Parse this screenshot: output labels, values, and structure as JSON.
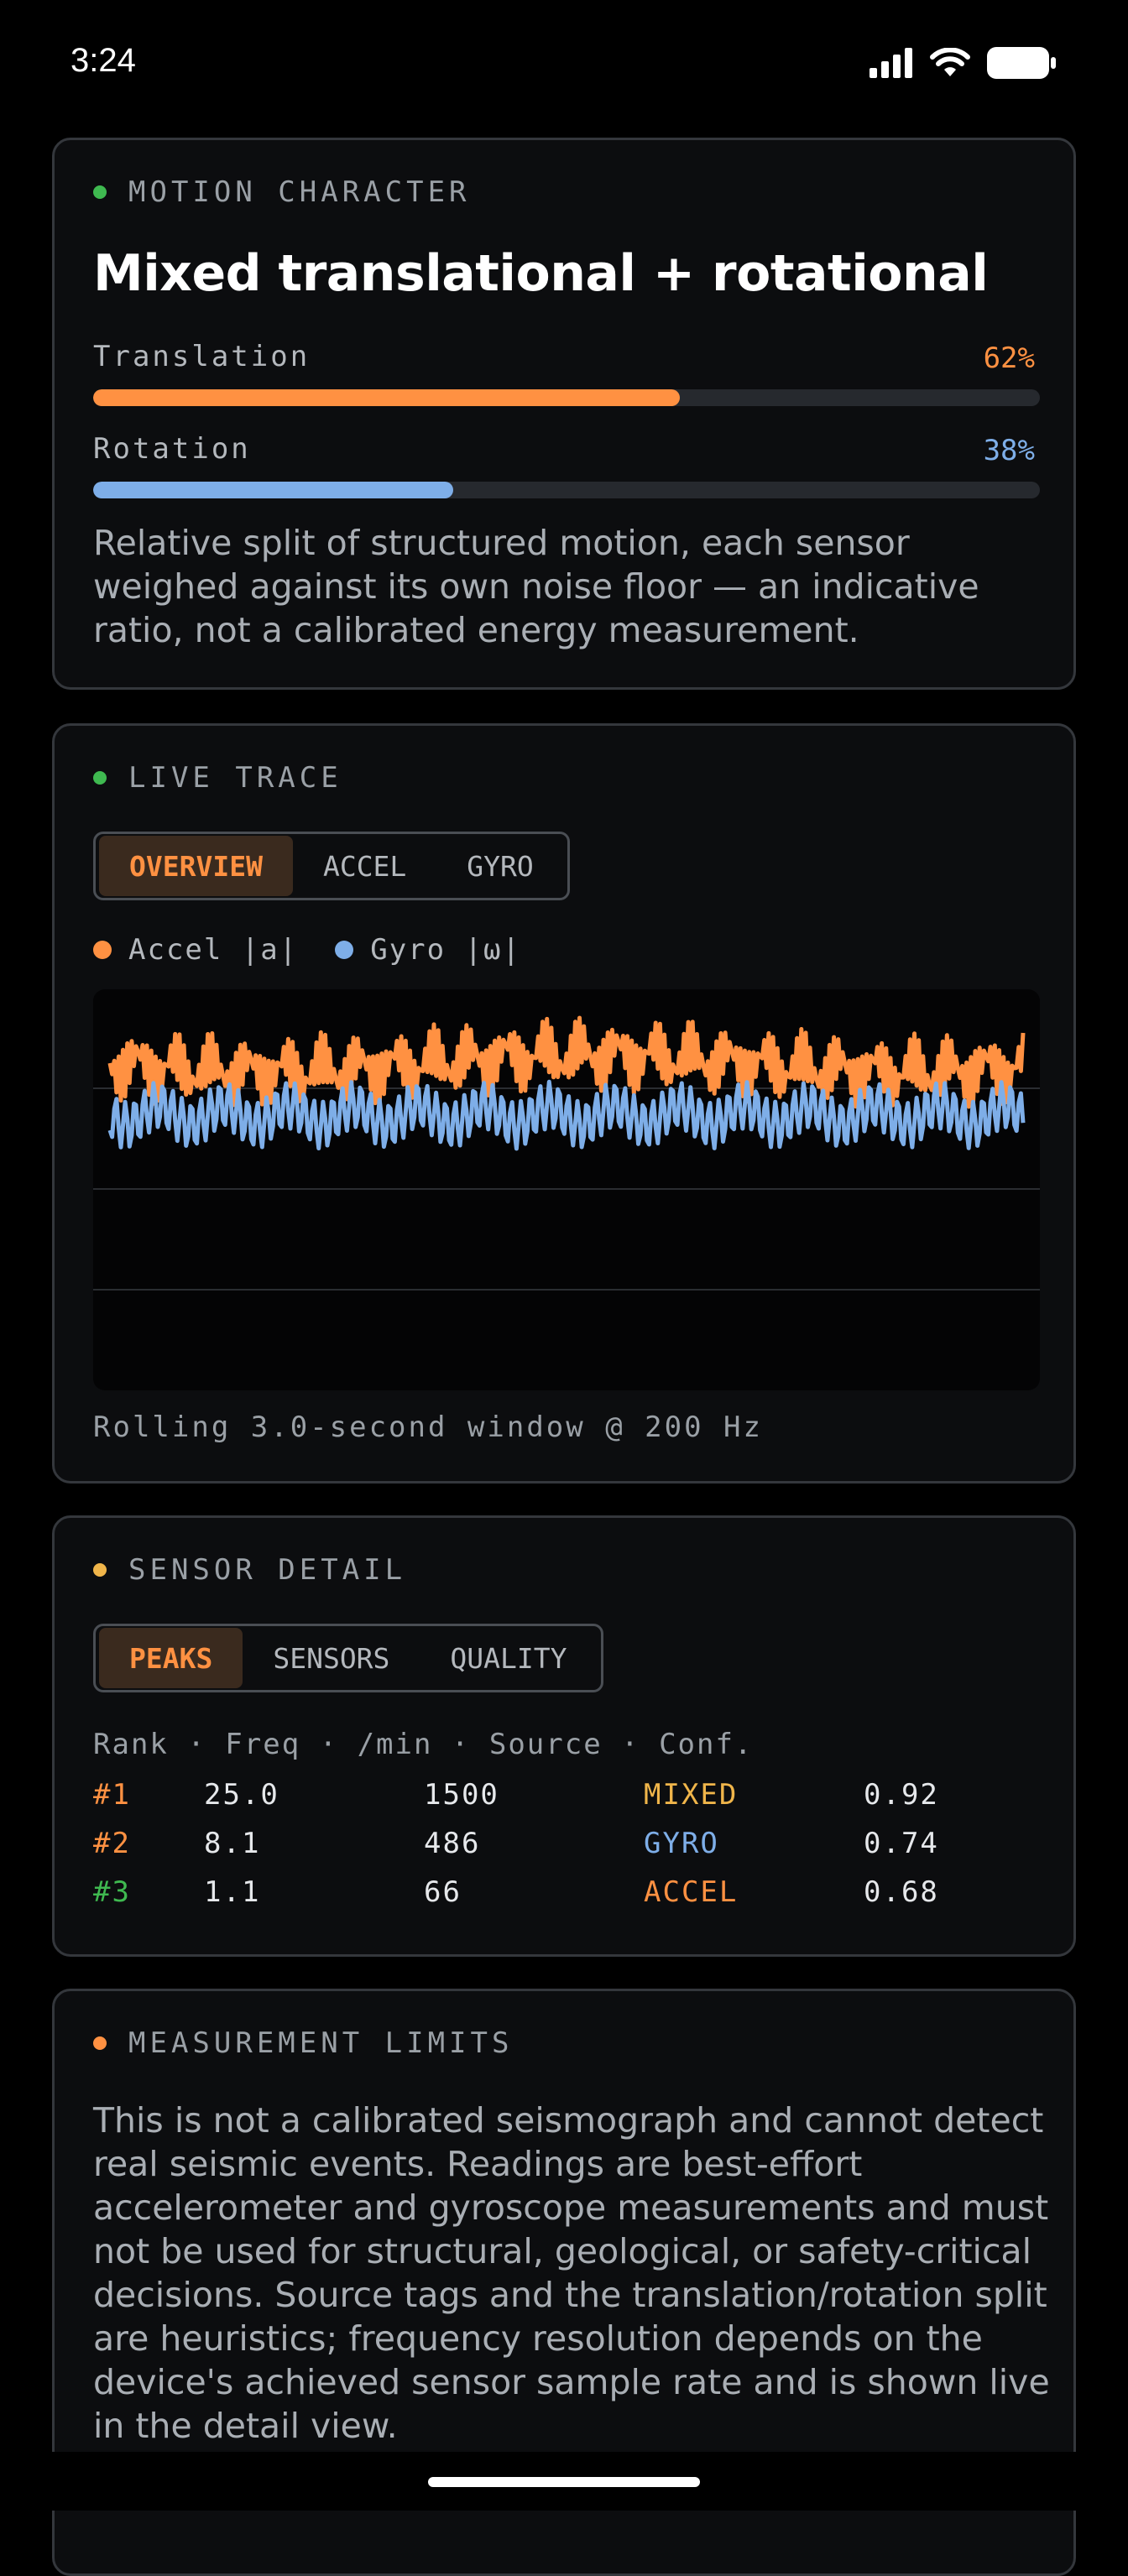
{
  "status_bar": {
    "time": "3:24"
  },
  "motion": {
    "title": "MOTION CHARACTER",
    "dot_color": "#3fb950",
    "headline": "Mixed translational + rotational",
    "translation": {
      "label": "Translation",
      "value_text": "62%",
      "fraction": 0.62,
      "color": "#ff9142"
    },
    "rotation": {
      "label": "Rotation",
      "value_text": "38%",
      "fraction": 0.38,
      "color": "#7eaee8"
    },
    "description": "Relative split of structured motion, each sensor weighed against its own noise floor — an indicative ratio, not a calibrated energy measurement."
  },
  "live": {
    "title": "LIVE TRACE",
    "dot_color": "#3fb950",
    "tabs": [
      "OVERVIEW",
      "ACCEL",
      "GYRO"
    ],
    "active_tab": "OVERVIEW",
    "legend": [
      {
        "label": "Accel |a|",
        "color": "#ff9142"
      },
      {
        "label": "Gyro |ω|",
        "color": "#7eaee8"
      }
    ],
    "caption": "Rolling 3.0-second window @ 200 Hz"
  },
  "sensor": {
    "title": "SENSOR DETAIL",
    "dot_color": "#f0b54a",
    "tabs": [
      "PEAKS",
      "SENSORS",
      "QUALITY"
    ],
    "active_tab": "PEAKS",
    "header": "Rank · Freq · /min · Source · Conf.",
    "rows": [
      {
        "rank": "#1",
        "freq": "25.0",
        "per_min": "1500",
        "source": "MIXED",
        "conf": "0.92",
        "rank_color": "#ff9142",
        "source_color": "#f0b54a"
      },
      {
        "rank": "#2",
        "freq": "8.1",
        "per_min": "486",
        "source": "GYRO",
        "conf": "0.74",
        "rank_color": "#ff9142",
        "source_color": "#7eaee8"
      },
      {
        "rank": "#3",
        "freq": "1.1",
        "per_min": "66",
        "source": "ACCEL",
        "conf": "0.68",
        "rank_color": "#3fb950",
        "source_color": "#ff9142"
      }
    ]
  },
  "limits": {
    "title": "MEASUREMENT LIMITS",
    "dot_color": "#ff9142",
    "text": "This is not a calibrated seismograph and cannot detect real seismic events. Readings are best-effort accelerometer and gyroscope measurements and must not be used for structural, geological, or safety-critical decisions. Source tags and the translation/rotation split are heuristics; frequency resolution depends on the device's achieved sensor sample rate and is shown live in the detail view."
  }
}
